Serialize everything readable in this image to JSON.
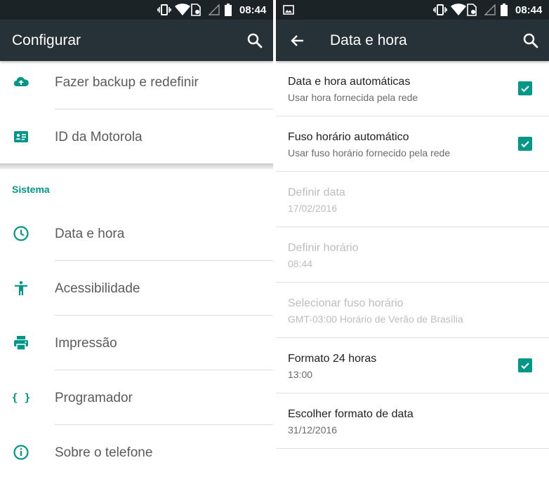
{
  "status_bar": {
    "time": "08:44"
  },
  "left": {
    "title": "Configurar",
    "items_top": [
      {
        "label": "Fazer backup e redefinir",
        "icon": "cloud-upload-icon"
      },
      {
        "label": "ID da Motorola",
        "icon": "id-card-icon"
      }
    ],
    "section_header": "Sistema",
    "items_system": [
      {
        "label": "Data e hora",
        "icon": "clock-icon"
      },
      {
        "label": "Acessibilidade",
        "icon": "accessibility-icon"
      },
      {
        "label": "Impressão",
        "icon": "printer-icon"
      },
      {
        "label": "Programador",
        "icon": "braces-icon"
      },
      {
        "label": "Sobre o telefone",
        "icon": "info-icon"
      }
    ]
  },
  "right": {
    "title": "Data e hora",
    "prefs": [
      {
        "title": "Data e hora automáticas",
        "summary": "Usar hora fornecida pela rede",
        "checked": true,
        "enabled": true
      },
      {
        "title": "Fuso horário automático",
        "summary": "Usar fuso horário fornecido pela rede",
        "checked": true,
        "enabled": true
      },
      {
        "title": "Definir data",
        "summary": "17/02/2016",
        "enabled": false
      },
      {
        "title": "Definir horário",
        "summary": "08:44",
        "enabled": false
      },
      {
        "title": "Selecionar fuso horário",
        "summary": "GMT-03:00 Horário de Verão de Brasília",
        "enabled": false
      },
      {
        "title": "Formato 24 horas",
        "summary": "13:00",
        "checked": true,
        "enabled": true
      },
      {
        "title": "Escolher formato de data",
        "summary": "31/12/2016",
        "enabled": true
      }
    ]
  },
  "colors": {
    "accent": "#009688",
    "appbar": "#263238",
    "statusbar": "#1b2326"
  }
}
